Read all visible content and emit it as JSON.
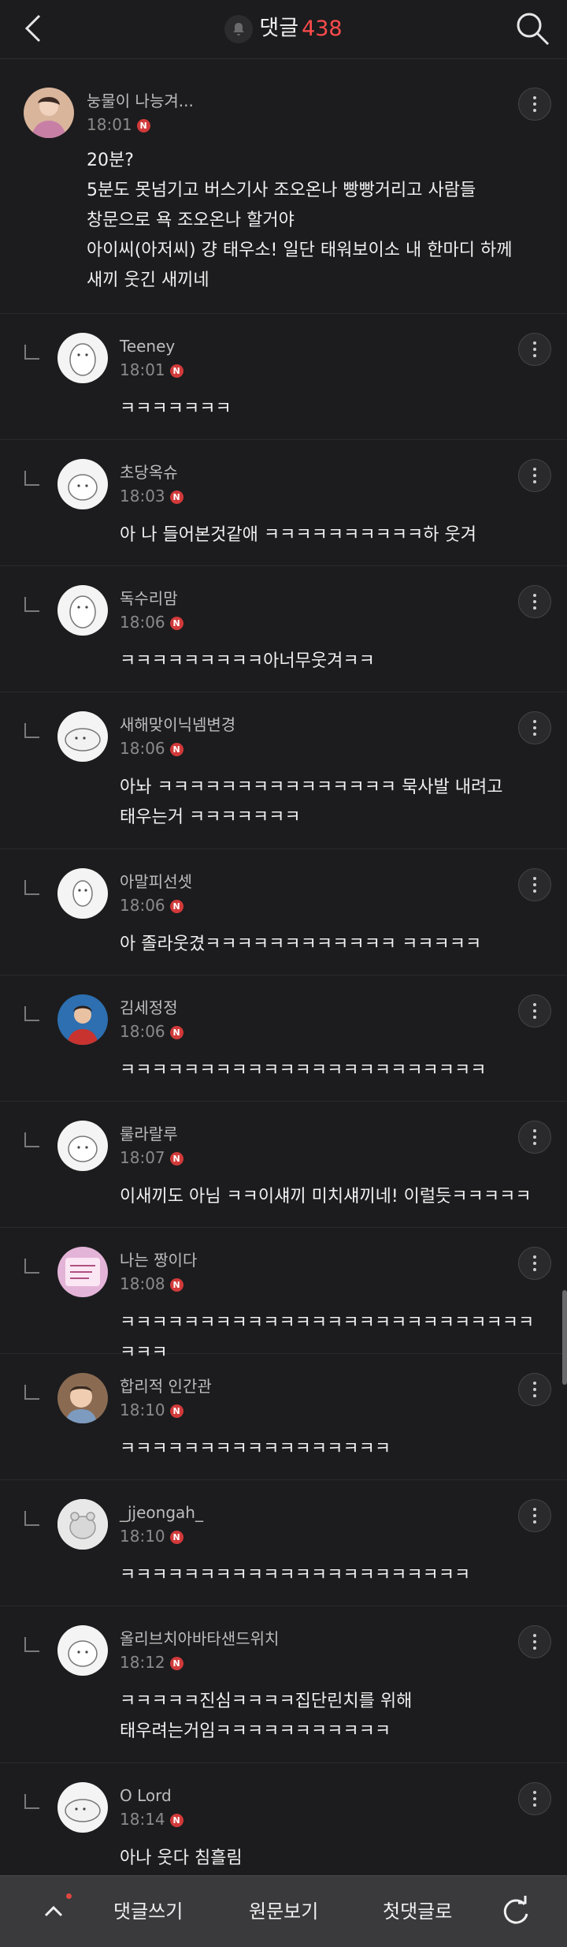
{
  "header": {
    "title": "댓글",
    "count": "438",
    "back_icon": "chevron-left-icon",
    "search_icon": "search-icon",
    "bell_icon": "bell-icon",
    "accent": "#ff4b4b"
  },
  "comments": [
    {
      "nick": "눙물이 나능겨...",
      "time": "18:01",
      "body": "20분?\n5분도 못넘기고 버스기사 조오온나 빵빵거리고 사람들\n창문으로 욕 조오온나 할거야\n아이씨(아저씨) 걍 태우소! 일단 태워보이소 내 한마디 하께\n새끼 웃긴 새끼네"
    },
    {
      "nick": "Teeney",
      "time": "18:01",
      "body": "ㅋㅋㅋㅋㅋㅋㅋ"
    },
    {
      "nick": "초당옥슈",
      "time": "18:03",
      "body": "아 나 들어본것같애 ㅋㅋㅋㅋㅋㅋㅋㅋㅋㅋ하 웃겨"
    },
    {
      "nick": "독수리맘",
      "time": "18:06",
      "body": "ㅋㅋㅋㅋㅋㅋㅋㅋㅋ아너무웃겨ㅋㅋ"
    },
    {
      "nick": "새해맞이닉넴변경",
      "time": "18:06",
      "body": "아놔 ㅋㅋㅋㅋㅋㅋㅋㅋㅋㅋㅋㅋㅋㅋㅋ 묵사발 내려고\n태우는거 ㅋㅋㅋㅋㅋㅋㅋ"
    },
    {
      "nick": "아말피선셋",
      "time": "18:06",
      "body": "아 졸라웃겼ㅋㅋㅋㅋㅋㅋㅋㅋㅋㅋㅋㅋ ㅋㅋㅋㅋㅋ"
    },
    {
      "nick": "김세정정",
      "time": "18:06",
      "body": "ㅋㅋㅋㅋㅋㅋㅋㅋㅋㅋㅋㅋㅋㅋㅋㅋㅋㅋㅋㅋㅋㅋㅋ"
    },
    {
      "nick": "룰라랄루",
      "time": "18:07",
      "body": "이새끼도 아님 ㅋㅋ이섀끼 미치섀끼네! 이럴듯ㅋㅋㅋㅋㅋ"
    },
    {
      "nick": "나는 짱이다",
      "time": "18:08",
      "body": "ㅋㅋㅋㅋㅋㅋㅋㅋㅋㅋㅋㅋㅋㅋㅋㅋㅋㅋㅋㅋㅋㅋㅋㅋㅋㅋㅋㅋㅋ"
    },
    {
      "nick": "합리적 인간관",
      "time": "18:10",
      "body": "ㅋㅋㅋㅋㅋㅋㅋㅋㅋㅋㅋㅋㅋㅋㅋㅋㅋ"
    },
    {
      "nick": "_jjeongah_",
      "time": "18:10",
      "body": "ㅋㅋㅋㅋㅋㅋㅋㅋㅋㅋㅋㅋㅋㅋㅋㅋㅋㅋㅋㅋㅋㅋ"
    },
    {
      "nick": "올리브치아바타샌드위치",
      "time": "18:12",
      "body": "ㅋㅋㅋㅋㅋ진심ㅋㅋㅋㅋ집단린치를 위해\n태우려는거임ㅋㅋㅋㅋㅋㅋㅋㅋㅋㅋㅋ"
    },
    {
      "nick": "O Lord",
      "time": "18:14",
      "body": "아나 웃다 침흘림"
    }
  ],
  "badge_letter": "N",
  "bottom": {
    "write": "댓글쓰기",
    "original": "원문보기",
    "first": "첫댓글로",
    "up_icon": "chevron-up-icon",
    "refresh_icon": "refresh-icon"
  }
}
